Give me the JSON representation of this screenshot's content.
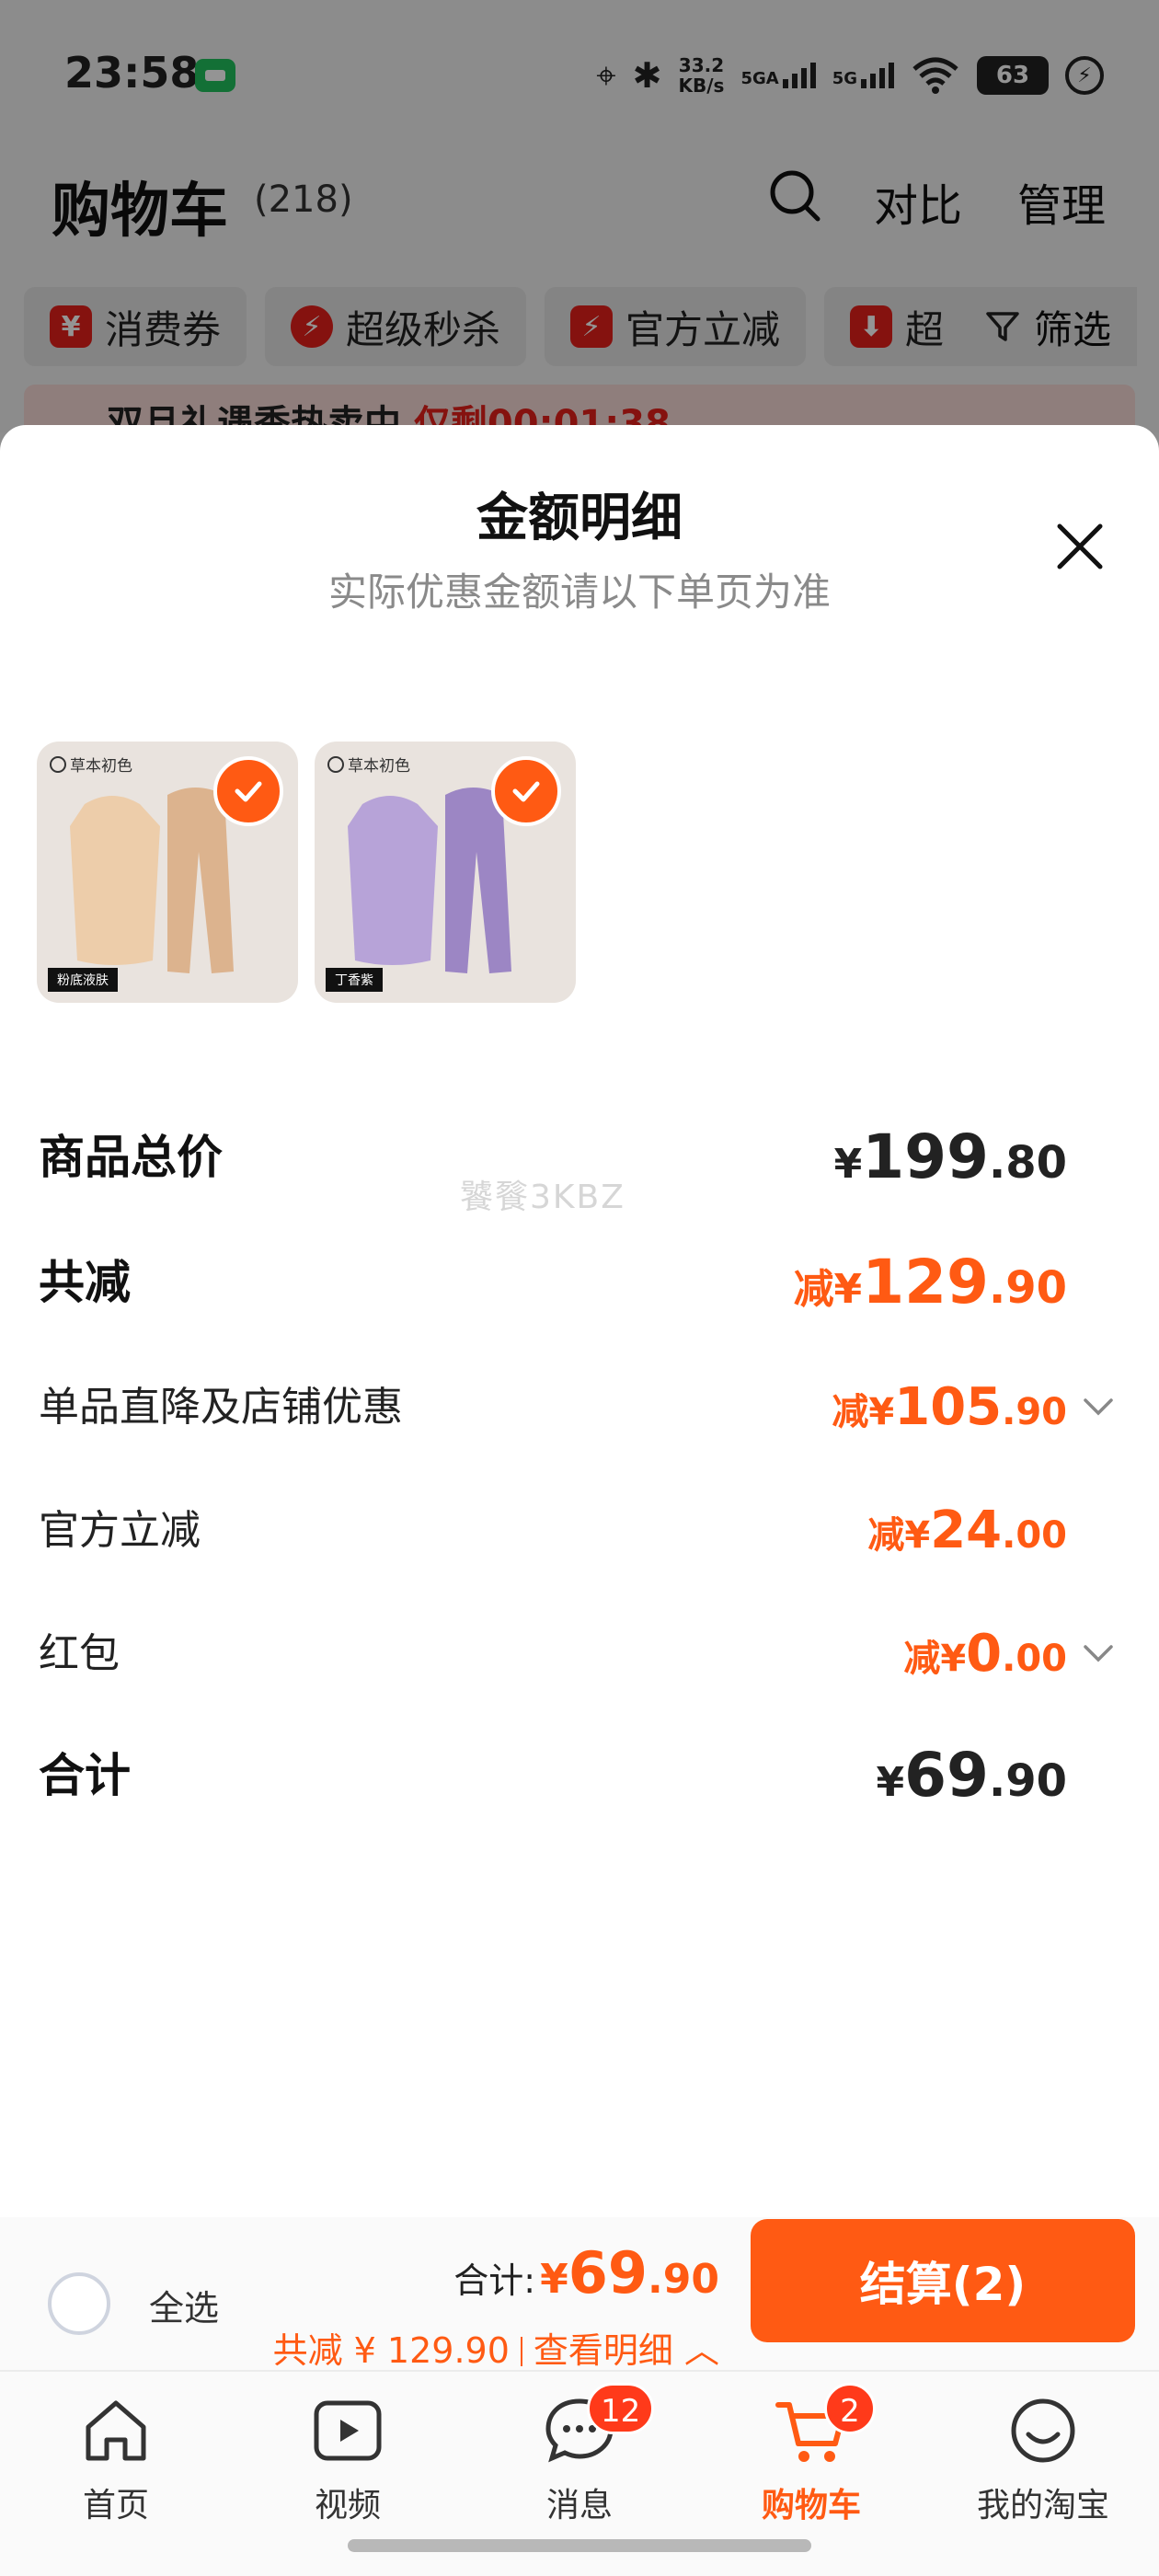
{
  "status_bar": {
    "time": "23:58",
    "net_speed_value": "33.2",
    "net_speed_unit": "KB/s",
    "sig1": "5GA",
    "sig2": "5G",
    "battery": "63"
  },
  "cart": {
    "title": "购物车",
    "count": "(218)",
    "compare": "对比",
    "manage": "管理"
  },
  "filters": [
    {
      "icon": "¥",
      "label": "消费券"
    },
    {
      "icon": "⚡",
      "label": "超级秒杀"
    },
    {
      "icon": "⚡",
      "label": "官方立减"
    },
    {
      "icon": "⬇",
      "label": "超"
    }
  ],
  "filter_button": "筛选",
  "promo": {
    "text": "双旦礼遇季热卖中",
    "countdown": "仅剩00:01:38"
  },
  "sheet": {
    "title": "金额明细",
    "subtitle": "实际优惠金额请以下单页为准",
    "products": [
      {
        "brand": "草本初色",
        "color_tag": "粉底液肤",
        "fill": "#edcdaa",
        "fill_dark": "#dcb38e"
      },
      {
        "brand": "草本初色",
        "color_tag": "丁香紫",
        "fill": "#b7a3d8",
        "fill_dark": "#9c86c4"
      }
    ],
    "rows": [
      {
        "label": "商品总价",
        "prefix": "¥",
        "int": "199",
        "dec": ".80",
        "style": "big",
        "color": "black",
        "chevron": false
      },
      {
        "label": "共减",
        "prefix": "减¥",
        "int": "129",
        "dec": ".90",
        "style": "big",
        "color": "orange",
        "chevron": false
      },
      {
        "label": "单品直降及店铺优惠",
        "prefix": "减¥",
        "int": "105",
        "dec": ".90",
        "style": "small",
        "color": "orange",
        "chevron": true
      },
      {
        "label": "官方立减",
        "prefix": "减¥",
        "int": "24",
        "dec": ".00",
        "style": "small",
        "color": "orange",
        "chevron": false
      },
      {
        "label": "红包",
        "prefix": "减¥",
        "int": "0",
        "dec": ".00",
        "style": "small",
        "color": "orange",
        "chevron": true
      },
      {
        "label": "合计",
        "prefix": "¥",
        "int": "69",
        "dec": ".90",
        "style": "big",
        "color": "black",
        "chevron": false
      }
    ],
    "watermark": "饕餮3KBZ"
  },
  "checkout": {
    "select_all": "全选",
    "total_label": "合计:",
    "total_prefix": "¥",
    "total_int": "69",
    "total_dec": ".90",
    "saving": "共减 ¥ 129.90",
    "detail_link": "查看明细 ︿",
    "button": "结算(2)"
  },
  "tabs": [
    {
      "label": "首页",
      "icon": "home-icon"
    },
    {
      "label": "视频",
      "icon": "video-icon"
    },
    {
      "label": "消息",
      "icon": "message-icon",
      "badge": "12"
    },
    {
      "label": "购物车",
      "icon": "cart-icon",
      "badge": "2",
      "active": true
    },
    {
      "label": "我的淘宝",
      "icon": "profile-icon"
    }
  ],
  "colors": {
    "accent": "#ff5a13",
    "badge": "#ff3a1a",
    "promo_red": "#e6201a"
  }
}
